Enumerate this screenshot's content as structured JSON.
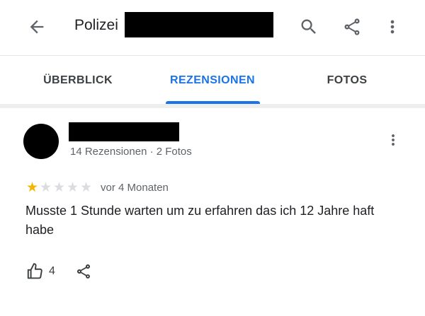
{
  "appbar": {
    "title": "Polizei",
    "icons": {
      "back": "arrow-back-icon",
      "search": "search-icon",
      "share": "share-icon",
      "more": "more-vert-icon"
    }
  },
  "tabs": [
    {
      "label": "ÜBERBLICK",
      "active": false
    },
    {
      "label": "REZENSIONEN",
      "active": true
    },
    {
      "label": "FOTOS",
      "active": false
    }
  ],
  "colors": {
    "accent": "#1a73e8",
    "star": "#f4b400",
    "star_empty": "#dadce0",
    "redaction": "#000000"
  },
  "review": {
    "reviewer_meta": "14 Rezensionen · 2 Fotos",
    "rating": 1,
    "rating_max": 5,
    "date": "vor 4 Monaten",
    "text": "Musste 1 Stunde warten um zu erfahren das ich 12 Jahre haft habe",
    "likes": "4"
  }
}
